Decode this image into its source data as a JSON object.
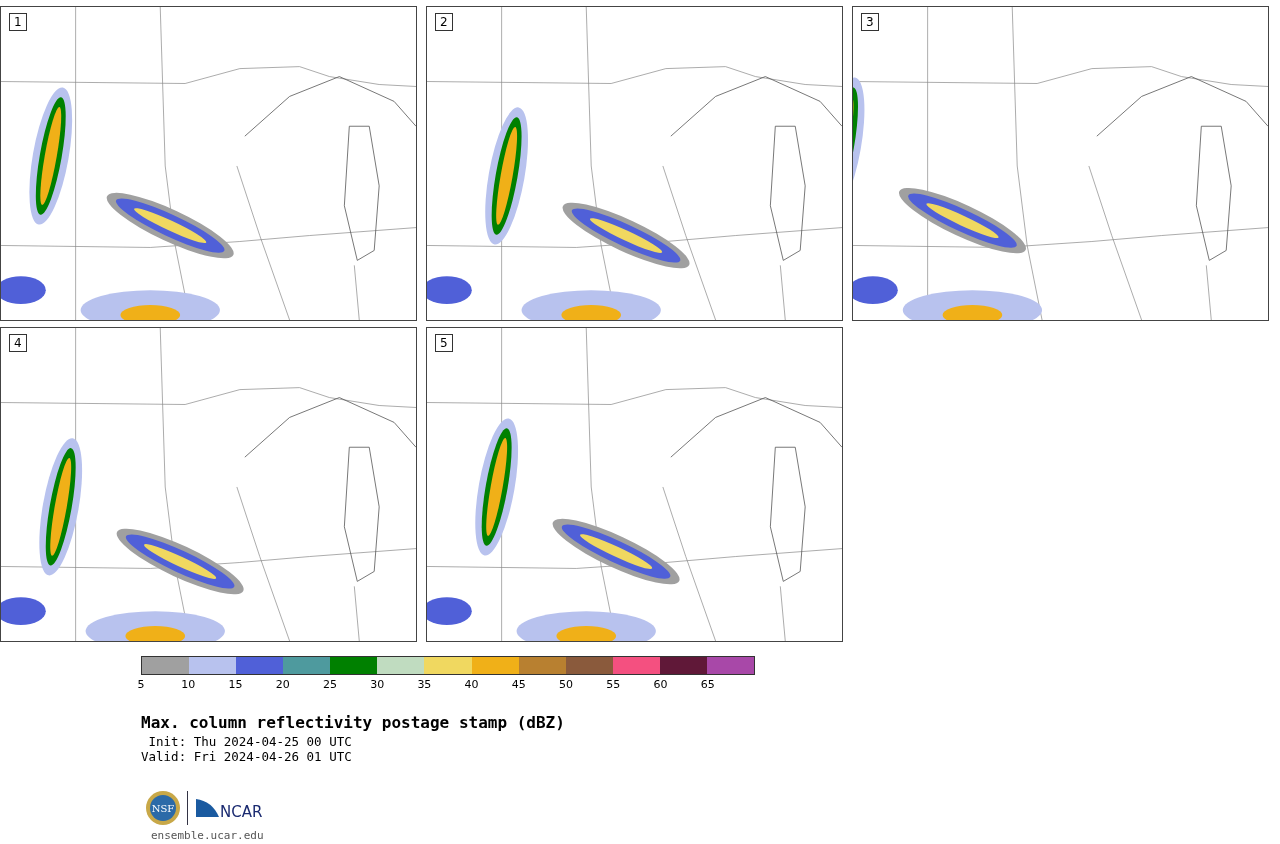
{
  "panels": [
    {
      "label": "1"
    },
    {
      "label": "2"
    },
    {
      "label": "3"
    },
    {
      "label": "4"
    },
    {
      "label": "5"
    }
  ],
  "colorbar": {
    "colors": [
      {
        "color": "#a0a0a0"
      },
      {
        "color": "#b8c2ee"
      },
      {
        "color": "#5060d8"
      },
      {
        "color": "#4e9a9e"
      },
      {
        "color": "#008000"
      },
      {
        "color": "#c0dcc0"
      },
      {
        "color": "#f0d860"
      },
      {
        "color": "#f0b018"
      },
      {
        "color": "#b88030"
      },
      {
        "color": "#8a5a3c"
      },
      {
        "color": "#f45080"
      },
      {
        "color": "#601838"
      },
      {
        "color": "#a848a8"
      }
    ],
    "ticks": [
      "5",
      "10",
      "15",
      "20",
      "25",
      "30",
      "35",
      "40",
      "45",
      "50",
      "55",
      "60",
      "65"
    ]
  },
  "title": "Max. column reflectivity postage stamp (dBZ)",
  "init": " Init: Thu 2024-04-25 00 UTC",
  "valid": "Valid: Fri 2024-04-26 01 UTC",
  "logo": {
    "nsf_text": "NSF",
    "ncar_text": "NCAR"
  },
  "site": "ensemble.ucar.edu"
}
